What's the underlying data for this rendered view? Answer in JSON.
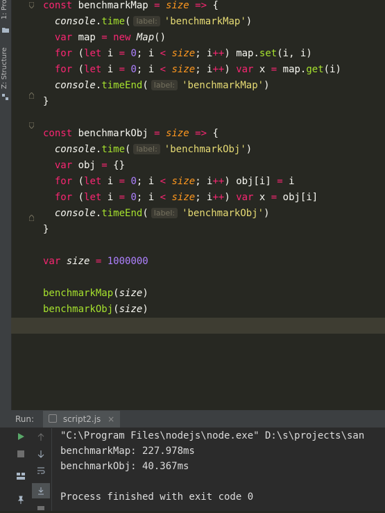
{
  "sidebar": {
    "tabs": [
      "1: Pro",
      "Z: Structure"
    ]
  },
  "editor": {
    "lines": [
      {
        "tokens": [
          [
            "kw",
            "const "
          ],
          [
            "plain",
            "benchmarkMap "
          ],
          [
            "op",
            "= "
          ],
          [
            "param",
            "size "
          ],
          [
            "op",
            "=> "
          ],
          [
            "plain",
            "{"
          ]
        ]
      },
      {
        "indent": true,
        "tokens": [
          [
            "it2",
            "console"
          ],
          [
            "plain",
            "."
          ],
          [
            "fnd",
            "time"
          ],
          [
            "plain",
            "("
          ],
          [
            "hint",
            "label:"
          ],
          [
            "str",
            "'benchmarkMap'"
          ],
          [
            "plain",
            ")"
          ]
        ]
      },
      {
        "indent": true,
        "tokens": [
          [
            "kw",
            "var "
          ],
          [
            "plain",
            "map "
          ],
          [
            "op",
            "= "
          ],
          [
            "kw",
            "new "
          ],
          [
            "it2",
            "Map"
          ],
          [
            "plain",
            "()"
          ]
        ]
      },
      {
        "indent": true,
        "tokens": [
          [
            "kw",
            "for "
          ],
          [
            "plain",
            "("
          ],
          [
            "kw",
            "let "
          ],
          [
            "plain",
            "i "
          ],
          [
            "op",
            "= "
          ],
          [
            "num",
            "0"
          ],
          [
            "plain",
            "; i "
          ],
          [
            "op",
            "< "
          ],
          [
            "param",
            "size"
          ],
          [
            "plain",
            "; i"
          ],
          [
            "op",
            "++"
          ],
          [
            "plain",
            ") map."
          ],
          [
            "fnd",
            "set"
          ],
          [
            "plain",
            "(i, i)"
          ]
        ]
      },
      {
        "indent": true,
        "tokens": [
          [
            "kw",
            "for "
          ],
          [
            "plain",
            "("
          ],
          [
            "kw",
            "let "
          ],
          [
            "plain",
            "i "
          ],
          [
            "op",
            "= "
          ],
          [
            "num",
            "0"
          ],
          [
            "plain",
            "; i "
          ],
          [
            "op",
            "< "
          ],
          [
            "param",
            "size"
          ],
          [
            "plain",
            "; i"
          ],
          [
            "op",
            "++"
          ],
          [
            "plain",
            ") "
          ],
          [
            "kw",
            "var "
          ],
          [
            "plain",
            "x "
          ],
          [
            "op",
            "= "
          ],
          [
            "plain",
            "map."
          ],
          [
            "fnd",
            "get"
          ],
          [
            "plain",
            "(i)"
          ]
        ]
      },
      {
        "indent": true,
        "tokens": [
          [
            "it2",
            "console"
          ],
          [
            "plain",
            "."
          ],
          [
            "fnd",
            "timeEnd"
          ],
          [
            "plain",
            "("
          ],
          [
            "hint",
            "label:"
          ],
          [
            "str",
            "'benchmarkMap'"
          ],
          [
            "plain",
            ")"
          ]
        ]
      },
      {
        "tokens": [
          [
            "plain",
            "}"
          ]
        ]
      },
      {
        "tokens": []
      },
      {
        "tokens": [
          [
            "kw",
            "const "
          ],
          [
            "plain",
            "benchmarkObj "
          ],
          [
            "op",
            "= "
          ],
          [
            "param",
            "size "
          ],
          [
            "op",
            "=> "
          ],
          [
            "plain",
            "{"
          ]
        ]
      },
      {
        "indent": true,
        "tokens": [
          [
            "it2",
            "console"
          ],
          [
            "plain",
            "."
          ],
          [
            "fnd",
            "time"
          ],
          [
            "plain",
            "("
          ],
          [
            "hint",
            "label:"
          ],
          [
            "str",
            "'benchmarkObj'"
          ],
          [
            "plain",
            ")"
          ]
        ]
      },
      {
        "indent": true,
        "tokens": [
          [
            "kw",
            "var "
          ],
          [
            "plain",
            "obj "
          ],
          [
            "op",
            "= "
          ],
          [
            "plain",
            "{}"
          ]
        ]
      },
      {
        "indent": true,
        "tokens": [
          [
            "kw",
            "for "
          ],
          [
            "plain",
            "("
          ],
          [
            "kw",
            "let "
          ],
          [
            "plain",
            "i "
          ],
          [
            "op",
            "= "
          ],
          [
            "num",
            "0"
          ],
          [
            "plain",
            "; i "
          ],
          [
            "op",
            "< "
          ],
          [
            "param",
            "size"
          ],
          [
            "plain",
            "; i"
          ],
          [
            "op",
            "++"
          ],
          [
            "plain",
            ") obj[i] "
          ],
          [
            "op",
            "= "
          ],
          [
            "plain",
            "i"
          ]
        ]
      },
      {
        "indent": true,
        "tokens": [
          [
            "kw",
            "for "
          ],
          [
            "plain",
            "("
          ],
          [
            "kw",
            "let "
          ],
          [
            "plain",
            "i "
          ],
          [
            "op",
            "= "
          ],
          [
            "num",
            "0"
          ],
          [
            "plain",
            "; i "
          ],
          [
            "op",
            "< "
          ],
          [
            "param",
            "size"
          ],
          [
            "plain",
            "; i"
          ],
          [
            "op",
            "++"
          ],
          [
            "plain",
            ") "
          ],
          [
            "kw",
            "var "
          ],
          [
            "plain",
            "x "
          ],
          [
            "op",
            "= "
          ],
          [
            "plain",
            "obj[i]"
          ]
        ]
      },
      {
        "indent": true,
        "tokens": [
          [
            "it2",
            "console"
          ],
          [
            "plain",
            "."
          ],
          [
            "fnd",
            "timeEnd"
          ],
          [
            "plain",
            "("
          ],
          [
            "hint",
            "label:"
          ],
          [
            "str",
            "'benchmarkObj'"
          ],
          [
            "plain",
            ")"
          ]
        ]
      },
      {
        "tokens": [
          [
            "plain",
            "}"
          ]
        ]
      },
      {
        "tokens": []
      },
      {
        "tokens": [
          [
            "kw",
            "var "
          ],
          [
            "it2",
            "size "
          ],
          [
            "op",
            "= "
          ],
          [
            "num",
            "1000000"
          ]
        ]
      },
      {
        "tokens": []
      },
      {
        "tokens": [
          [
            "fn",
            "benchmarkMap"
          ],
          [
            "plain",
            "("
          ],
          [
            "it2",
            "size"
          ],
          [
            "plain",
            ")"
          ]
        ]
      },
      {
        "tokens": [
          [
            "fn",
            "benchmarkObj"
          ],
          [
            "plain",
            "("
          ],
          [
            "it2",
            "size"
          ],
          [
            "plain",
            ")"
          ]
        ]
      },
      {
        "current": true,
        "tokens": []
      }
    ]
  },
  "run_panel": {
    "label": "Run:",
    "tab_name": "script2.js",
    "tab_close": "×",
    "output": [
      "\"C:\\Program Files\\nodejs\\node.exe\" D:\\s\\projects\\san",
      "benchmarkMap: 227.978ms",
      "benchmarkObj: 40.367ms",
      "",
      "Process finished with exit code 0"
    ]
  },
  "colors": {
    "keyword": "#f92672",
    "string": "#e6db74",
    "number": "#ae81ff",
    "function": "#a6e22e",
    "param": "#fd971f",
    "background": "#272822"
  }
}
